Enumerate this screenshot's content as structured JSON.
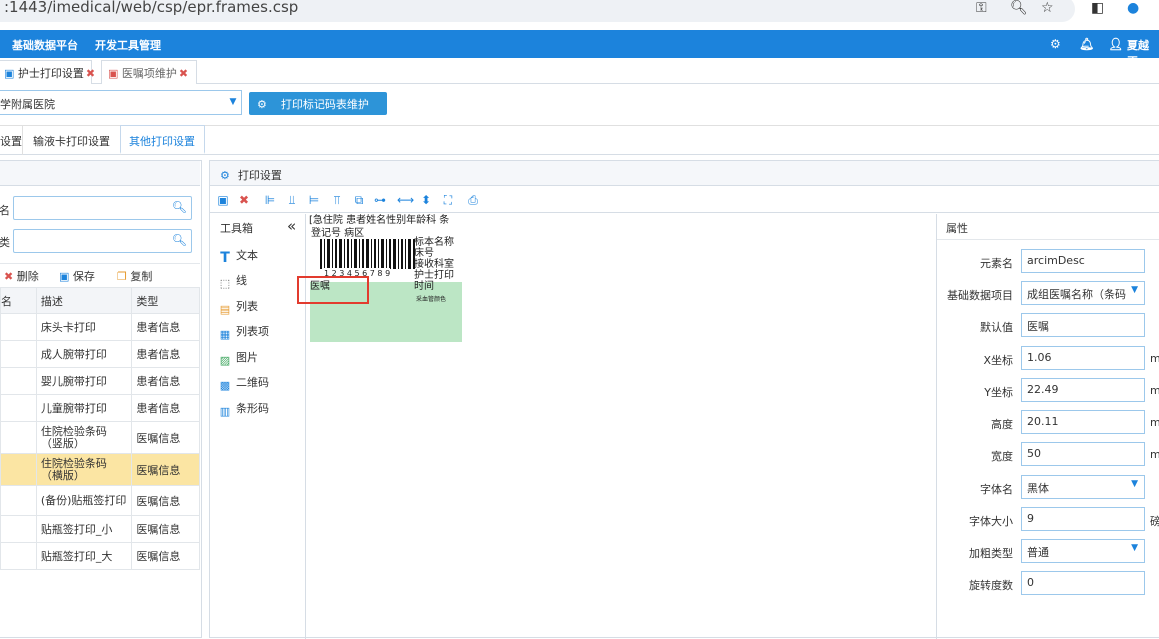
{
  "browser": {
    "url": ":1443/imedical/web/csp/epr.frames.csp",
    "icons": [
      "key-icon",
      "zoom-icon",
      "star-icon",
      "sidepanel-icon",
      "profile-icon"
    ]
  },
  "appbar": {
    "menu": [
      "基础数据平台",
      "开发工具管理"
    ],
    "user": "夏越正"
  },
  "page_tabs": [
    {
      "label": "护士打印设置",
      "close": "✖"
    },
    {
      "label": "医嘱项维护",
      "close": "✖"
    }
  ],
  "hospital": {
    "value": "学附属医院"
  },
  "print_button": "打印标记码表维护",
  "sub_tabs": [
    "设置",
    "输液卡打印设置",
    "其他打印设置"
  ],
  "left": {
    "search1_label": "名",
    "search2_label": "类",
    "toolbar": {
      "delete": "删除",
      "save": "保存",
      "copy": "复制"
    },
    "columns": [
      "名",
      "描述",
      "类型"
    ],
    "rows": [
      {
        "desc": "床头卡打印",
        "type": "患者信息"
      },
      {
        "desc": "成人腕带打印",
        "type": "患者信息"
      },
      {
        "desc": "婴儿腕带打印",
        "type": "患者信息"
      },
      {
        "desc": "儿童腕带打印",
        "type": "患者信息"
      },
      {
        "desc": "住院检验条码（竖版）",
        "type": "医嘱信息"
      },
      {
        "desc": "住院检验条码（横版）",
        "type": "医嘱信息"
      },
      {
        "desc": "(备份)贴瓶签打印",
        "type": "医嘱信息"
      },
      {
        "desc": "贴瓶签打印_小",
        "type": "医嘱信息"
      },
      {
        "desc": "贴瓶签打印_大",
        "type": "医嘱信息"
      }
    ]
  },
  "print_panel": {
    "title": "打印设置",
    "toolbox": {
      "title": "工具箱",
      "collapse": "«",
      "items": [
        {
          "label": "文本",
          "icon": "text-icon",
          "glyph": "T"
        },
        {
          "label": "线",
          "icon": "line-icon",
          "glyph": "⬚"
        },
        {
          "label": "列表",
          "icon": "list-icon",
          "glyph": "▤"
        },
        {
          "label": "列表项",
          "icon": "table-icon",
          "glyph": "▦"
        },
        {
          "label": "图片",
          "icon": "image-icon",
          "glyph": "▨"
        },
        {
          "label": "二维码",
          "icon": "qrcode-icon",
          "glyph": "▩"
        },
        {
          "label": "条形码",
          "icon": "barcode-icon",
          "glyph": "▥"
        }
      ]
    },
    "canvas": {
      "row1": "[急住院 患者姓名性别年龄科 条",
      "row2": "登记号      病区",
      "right_labels": [
        "标本名称",
        "床号",
        "接收科室",
        "护士打印",
        "时间"
      ],
      "barcode_digits": "1 2 3 4 5 6 7 8 9",
      "small_text": "采血管颜色",
      "element_label": "医嘱"
    }
  },
  "properties": {
    "title": "属性",
    "fields": [
      {
        "label": "元素名",
        "value": "arcimDesc",
        "dropdown": false,
        "unit": ""
      },
      {
        "label": "基础数据项目",
        "value": "成组医嘱名称（条码",
        "dropdown": true,
        "unit": ""
      },
      {
        "label": "默认值",
        "value": "医嘱",
        "dropdown": false,
        "unit": ""
      },
      {
        "label": "X坐标",
        "value": "1.06",
        "dropdown": false,
        "unit": "m"
      },
      {
        "label": "Y坐标",
        "value": "22.49",
        "dropdown": false,
        "unit": "m"
      },
      {
        "label": "高度",
        "value": "20.11",
        "dropdown": false,
        "unit": "m"
      },
      {
        "label": "宽度",
        "value": "50",
        "dropdown": false,
        "unit": "m"
      },
      {
        "label": "字体名",
        "value": "黑体",
        "dropdown": true,
        "unit": ""
      },
      {
        "label": "字体大小",
        "value": "9",
        "dropdown": false,
        "unit": "磅"
      },
      {
        "label": "加粗类型",
        "value": "普通",
        "dropdown": true,
        "unit": ""
      },
      {
        "label": "旋转度数",
        "value": "0",
        "dropdown": false,
        "unit": ""
      }
    ]
  },
  "colors": {
    "accent": "#1c83dc",
    "selected_row": "#fbe5a3",
    "canvas_box": "#bce6c5",
    "highlight": "#e23b2e"
  }
}
